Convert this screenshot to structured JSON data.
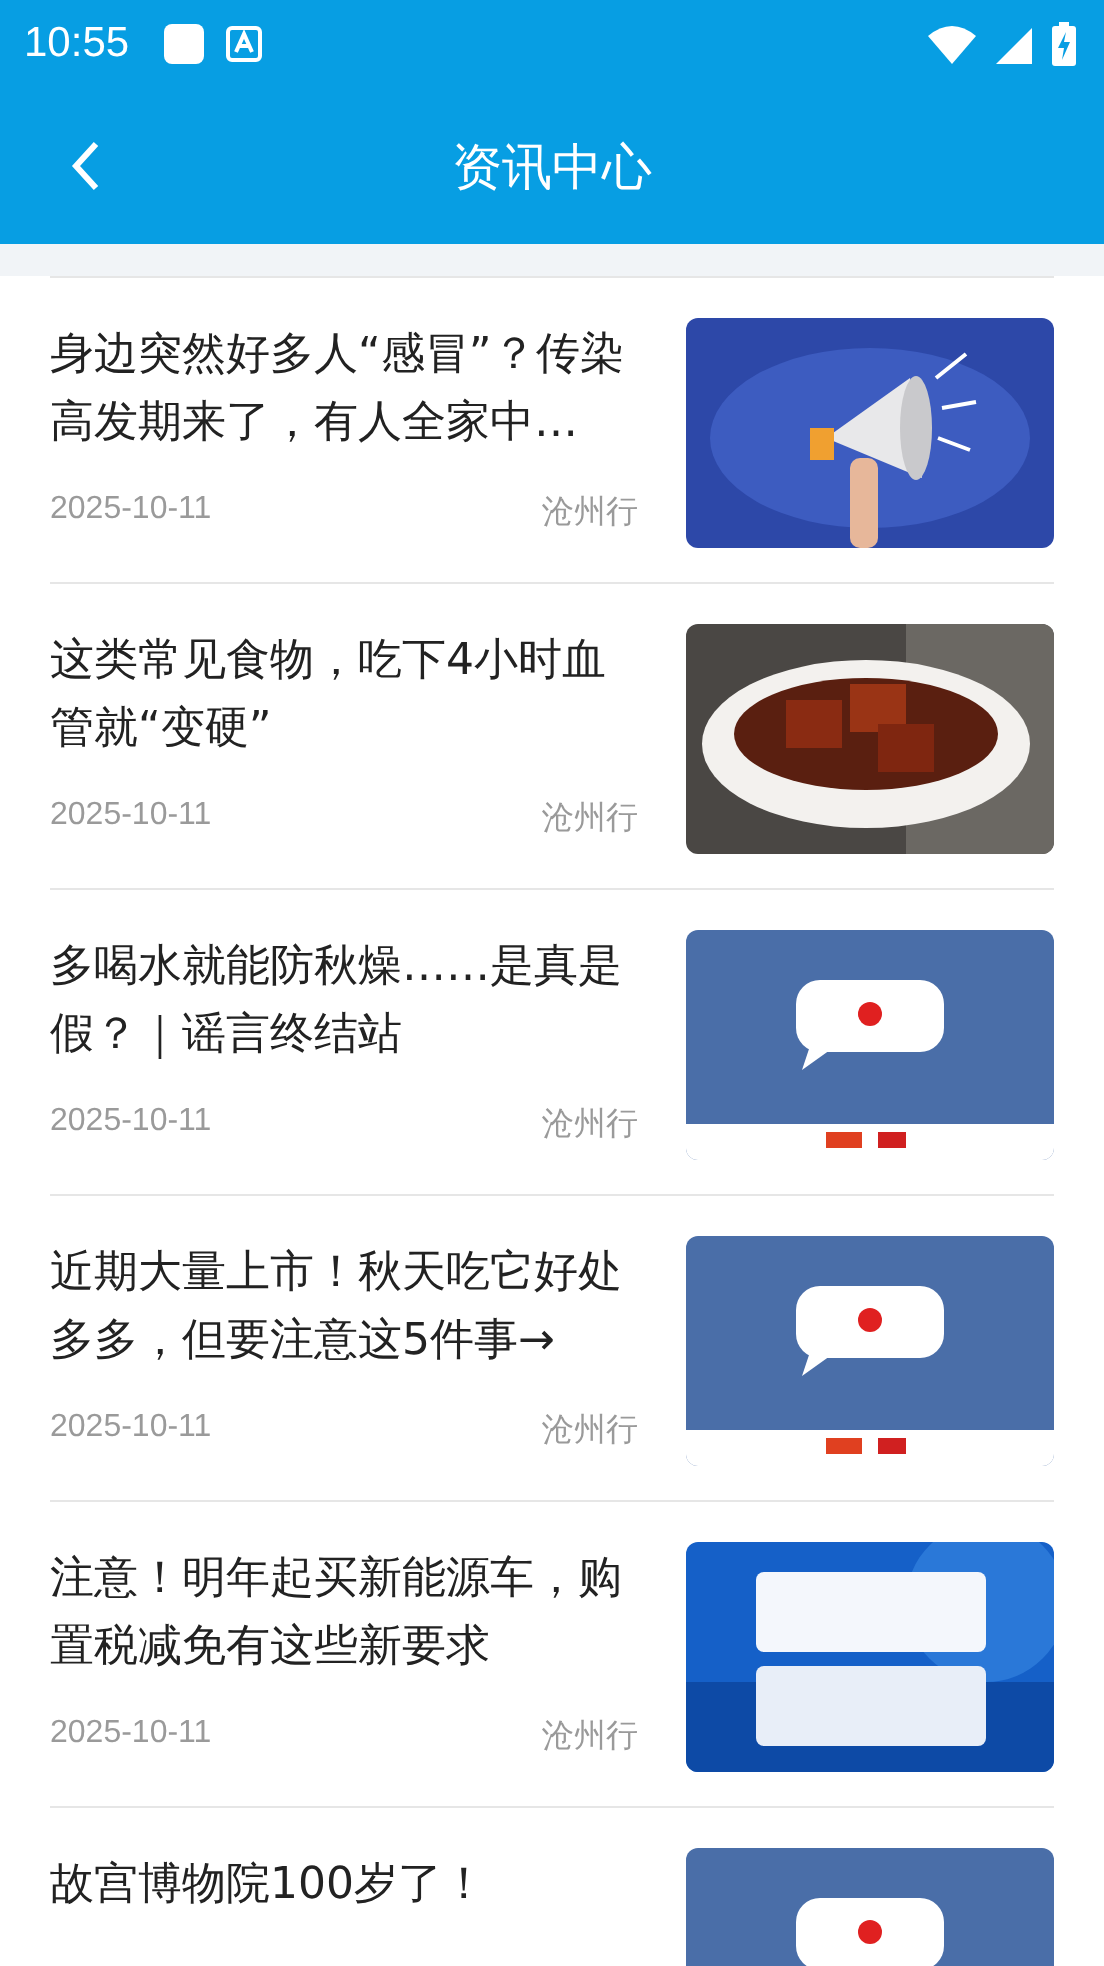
{
  "status_bar": {
    "time": "10:55"
  },
  "header": {
    "title": "资讯中心"
  },
  "articles": [
    {
      "title": "身边突然好多人“感冒”？传染高发期来了，有人全家中…",
      "date": "2025-10-11",
      "source": "沧州行"
    },
    {
      "title": "这类常见食物，吃下4小时血管就“变硬”",
      "date": "2025-10-11",
      "source": "沧州行"
    },
    {
      "title": "多喝水就能防秋燥……是真是假？｜谣言终结站",
      "date": "2025-10-11",
      "source": "沧州行"
    },
    {
      "title": "近期大量上市！秋天吃它好处多多，但要注意这5件事→",
      "date": "2025-10-11",
      "source": "沧州行"
    },
    {
      "title": "注意！明年起买新能源车，购置税减免有这些新要求",
      "date": "2025-10-11",
      "source": "沧州行"
    },
    {
      "title": "故宫博物院100岁了！"
    }
  ]
}
